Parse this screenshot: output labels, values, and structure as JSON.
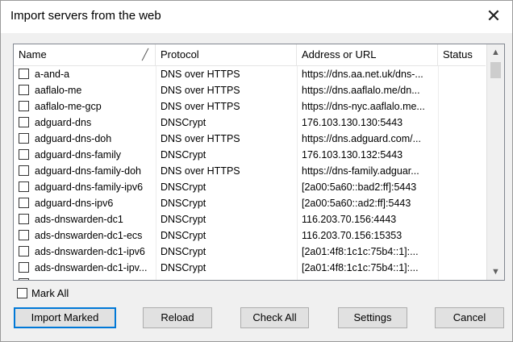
{
  "window": {
    "title": "Import servers from the web"
  },
  "columns": {
    "name": "Name",
    "protocol": "Protocol",
    "address": "Address or URL",
    "status": "Status"
  },
  "rows": [
    {
      "name": "a-and-a",
      "protocol": "DNS over HTTPS",
      "address": "https://dns.aa.net.uk/dns-...",
      "status": ""
    },
    {
      "name": "aaflalo-me",
      "protocol": "DNS over HTTPS",
      "address": "https://dns.aaflalo.me/dn...",
      "status": ""
    },
    {
      "name": "aaflalo-me-gcp",
      "protocol": "DNS over HTTPS",
      "address": "https://dns-nyc.aaflalo.me...",
      "status": ""
    },
    {
      "name": "adguard-dns",
      "protocol": "DNSCrypt",
      "address": "176.103.130.130:5443",
      "status": ""
    },
    {
      "name": "adguard-dns-doh",
      "protocol": "DNS over HTTPS",
      "address": "https://dns.adguard.com/...",
      "status": ""
    },
    {
      "name": "adguard-dns-family",
      "protocol": "DNSCrypt",
      "address": "176.103.130.132:5443",
      "status": ""
    },
    {
      "name": "adguard-dns-family-doh",
      "protocol": "DNS over HTTPS",
      "address": "https://dns-family.adguar...",
      "status": ""
    },
    {
      "name": "adguard-dns-family-ipv6",
      "protocol": "DNSCrypt",
      "address": "[2a00:5a60::bad2:ff]:5443",
      "status": ""
    },
    {
      "name": "adguard-dns-ipv6",
      "protocol": "DNSCrypt",
      "address": "[2a00:5a60::ad2:ff]:5443",
      "status": ""
    },
    {
      "name": "ads-dnswarden-dc1",
      "protocol": "DNSCrypt",
      "address": "116.203.70.156:4443",
      "status": ""
    },
    {
      "name": "ads-dnswarden-dc1-ecs",
      "protocol": "DNSCrypt",
      "address": "116.203.70.156:15353",
      "status": ""
    },
    {
      "name": "ads-dnswarden-dc1-ipv6",
      "protocol": "DNSCrypt",
      "address": "[2a01:4f8:1c1c:75b4::1]:...",
      "status": ""
    },
    {
      "name": "ads-dnswarden-dc1-ipv...",
      "protocol": "DNSCrypt",
      "address": "[2a01:4f8:1c1c:75b4::1]:...",
      "status": ""
    }
  ],
  "mark_all": {
    "label": "Mark All"
  },
  "buttons": {
    "import": "Import Marked",
    "reload": "Reload",
    "check_all": "Check All",
    "settings": "Settings",
    "cancel": "Cancel"
  },
  "icons": {
    "close": "close-icon",
    "sort": "sort-indicator-icon",
    "scroll_up": "scroll-up-icon",
    "scroll_down": "scroll-down-icon"
  }
}
